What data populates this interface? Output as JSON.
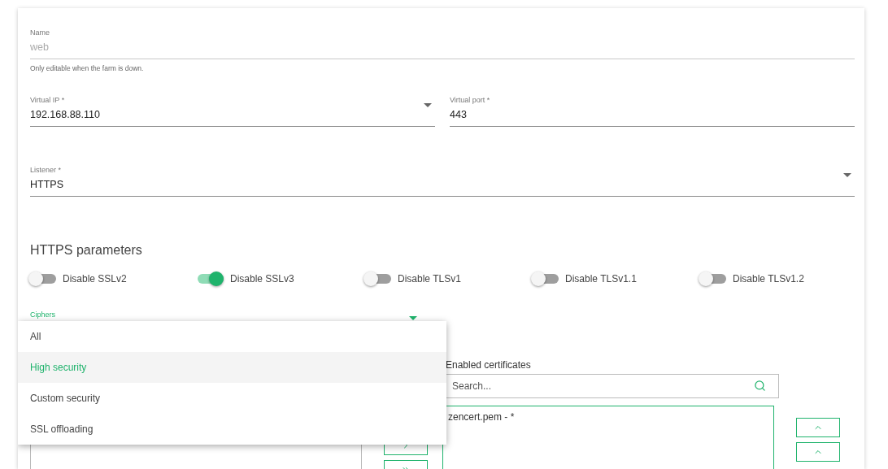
{
  "name_field": {
    "label": "Name",
    "value": "web",
    "disabled": true,
    "hint": "Only editable when the farm is down."
  },
  "virtual_ip": {
    "label": "Virtual IP *",
    "value": "192.168.88.110"
  },
  "virtual_port": {
    "label": "Virtual port *",
    "value": "443"
  },
  "listener": {
    "label": "Listener *",
    "value": "HTTPS"
  },
  "https_parameters": {
    "title": "HTTPS parameters",
    "toggles": [
      {
        "label": "Disable SSLv2",
        "on": false
      },
      {
        "label": "Disable SSLv3",
        "on": true
      },
      {
        "label": "Disable TLSv1",
        "on": false
      },
      {
        "label": "Disable TLSv1.1",
        "on": false
      },
      {
        "label": "Disable TLSv1.2",
        "on": false
      }
    ]
  },
  "ciphers": {
    "label": "Ciphers",
    "expanded": true,
    "options": [
      {
        "label": "All",
        "selected": false
      },
      {
        "label": "High security",
        "selected": true
      },
      {
        "label": "Custom security",
        "selected": false
      },
      {
        "label": "SSL offloading",
        "selected": false
      }
    ]
  },
  "enabled_certificates": {
    "label": "Enabled certificates",
    "search_placeholder": "Search...",
    "items": [
      "zencert.pem - *"
    ]
  }
}
